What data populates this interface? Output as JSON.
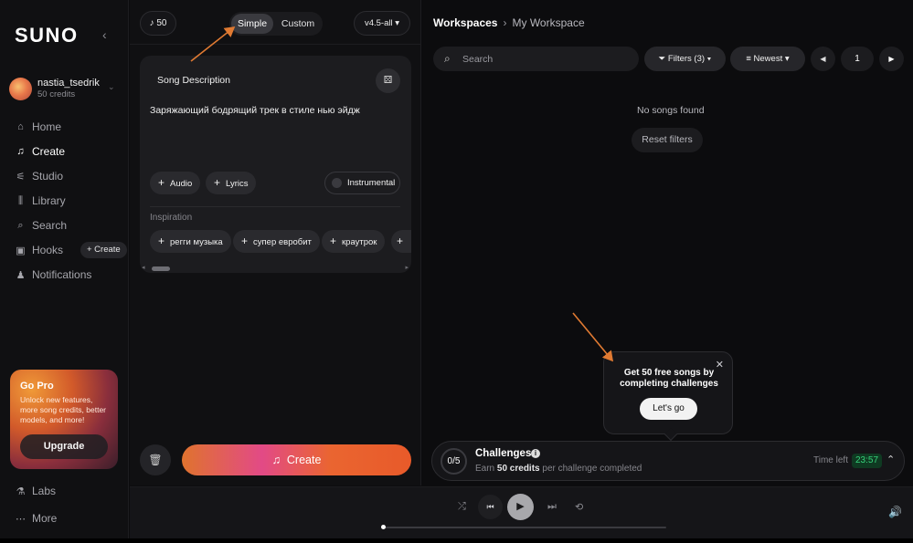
{
  "sidebar": {
    "logo": "SUNO",
    "user": {
      "name": "nastia_tsedrik",
      "credits": "50 credits"
    },
    "nav": [
      {
        "label": "Home",
        "icon": "home-icon"
      },
      {
        "label": "Create",
        "icon": "music-note-icon"
      },
      {
        "label": "Studio",
        "icon": "studio-icon"
      },
      {
        "label": "Library",
        "icon": "library-icon"
      },
      {
        "label": "Search",
        "icon": "search-icon"
      },
      {
        "label": "Hooks",
        "icon": "hooks-icon"
      },
      {
        "label": "Notifications",
        "icon": "bell-icon"
      }
    ],
    "hooks_create": "+ Create",
    "gopro": {
      "title": "Go Pro",
      "text": "Unlock new features, more song credits, better models, and more!",
      "button": "Upgrade"
    },
    "bottom": [
      {
        "label": "Labs",
        "icon": "flask-icon"
      },
      {
        "label": "More",
        "icon": "more-icon"
      }
    ]
  },
  "create_panel": {
    "credits": "50",
    "mode": {
      "simple": "Simple",
      "custom": "Custom",
      "selected": "Simple"
    },
    "version": "v4.5-all",
    "description_label": "Song Description",
    "description_text": "Заряжающий бодрящий трек в стиле нью эйдж",
    "chips": {
      "audio": "Audio",
      "lyrics": "Lyrics",
      "instrumental": "Instrumental"
    },
    "inspiration_label": "Inspiration",
    "inspiration": [
      "регги музыка",
      "супер евробит",
      "краутрок"
    ],
    "create_button": "Create"
  },
  "workspace": {
    "breadcrumb": [
      "Workspaces",
      "My Workspace"
    ],
    "search_placeholder": "Search",
    "filters": "Filters (3)",
    "sort": "Newest",
    "page": "1",
    "empty_text": "No songs found",
    "reset": "Reset filters"
  },
  "popup": {
    "text": "Get 50 free songs by completing challenges",
    "button": "Let's go"
  },
  "challenges": {
    "progress": "0/5",
    "title": "Challenges",
    "sub_prefix": "Earn",
    "sub_bold": "50 credits",
    "sub_suffix": "per challenge completed",
    "time_label": "Time left",
    "timer": "23:57"
  },
  "colors": {
    "accent_orange": "#e0732e",
    "accent_pink": "#e24a86",
    "annotation_arrow": "#e07a32",
    "timer_green": "#36d27a"
  }
}
